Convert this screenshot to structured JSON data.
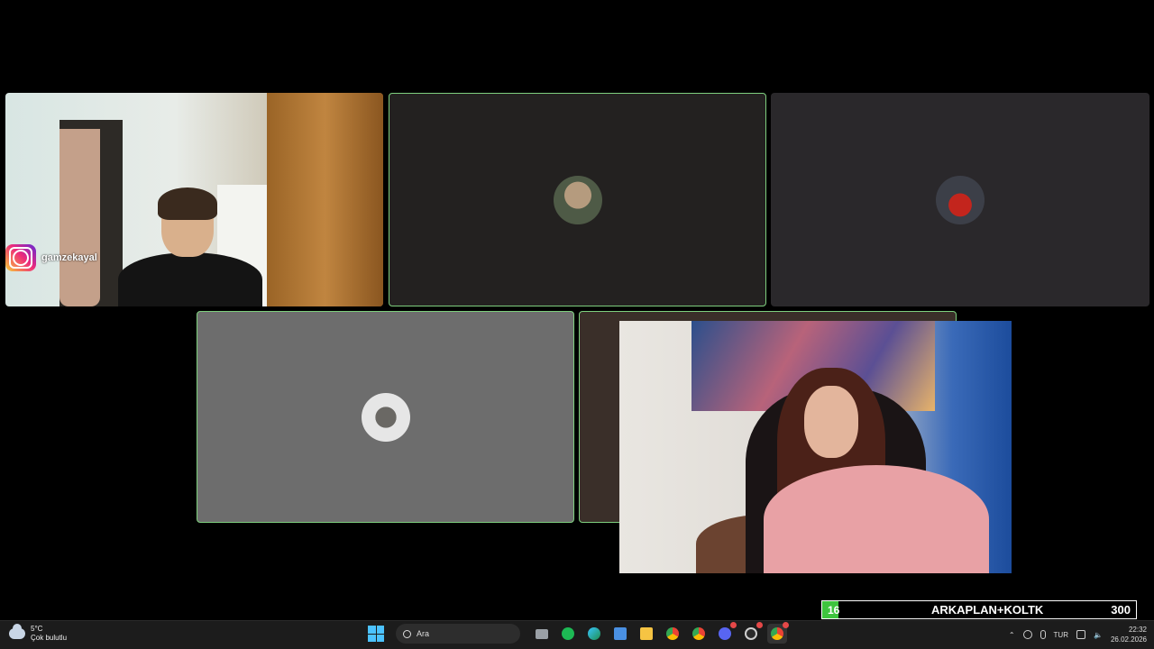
{
  "overlay": {
    "instagram_handle": "gamzekayal"
  },
  "goal": {
    "current": "16",
    "label": "ARKAPLAN+KOLTK",
    "max": "300",
    "progress_fraction": 0.053
  },
  "taskbar": {
    "weather": {
      "temp": "5°C",
      "condition": "Çok bulutlu"
    },
    "search_placeholder": "Ara",
    "apps": [
      "task-view-icon",
      "spotify-icon",
      "edge-icon",
      "store-icon",
      "file-explorer-icon",
      "chrome-icon",
      "chrome-profile-icon",
      "discord-icon",
      "settings-icon",
      "chrome-active-icon"
    ],
    "lang": "TUR",
    "time": "22:32",
    "date": "26.02.2026"
  }
}
